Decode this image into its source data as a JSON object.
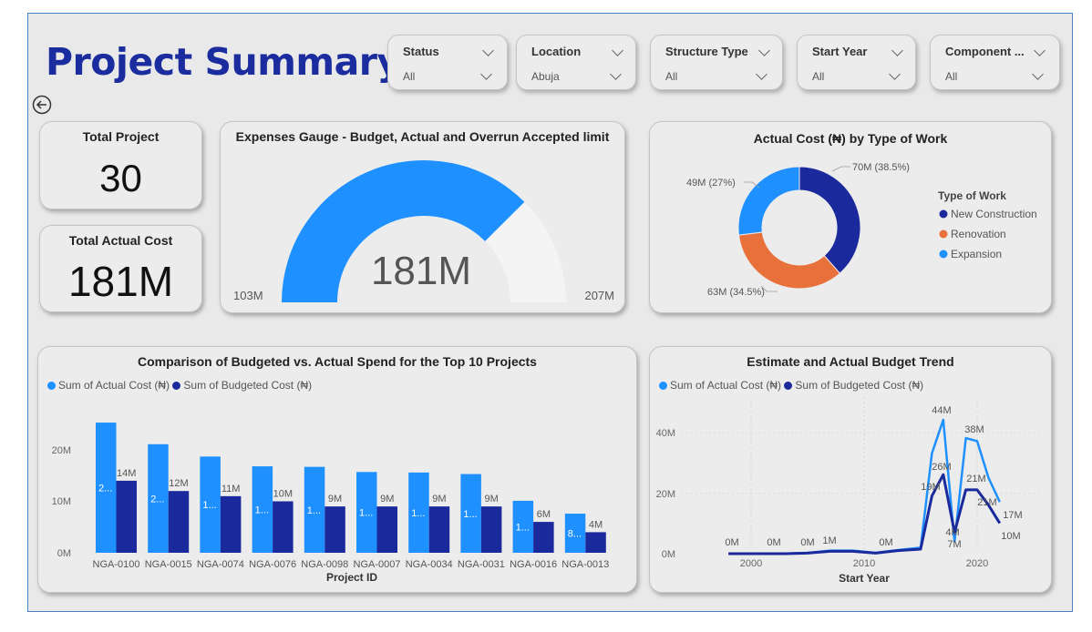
{
  "page": {
    "title": "Project Summary"
  },
  "colors": {
    "title": "#1b2d9e",
    "actual": "#1e90ff",
    "budgeted": "#1a2a9c",
    "renovation": "#e8703a",
    "gauge_track": "#f4f4f4"
  },
  "slicers": [
    {
      "title": "Status",
      "value": "All"
    },
    {
      "title": "Location",
      "value": "Abuja"
    },
    {
      "title": "Structure Type",
      "value": "All"
    },
    {
      "title": "Start Year",
      "value": "All"
    },
    {
      "title": "Component ...",
      "value": "All"
    }
  ],
  "kpis": {
    "total_project": {
      "label": "Total Project",
      "value": "30"
    },
    "total_actual_cost": {
      "label": "Total Actual Cost",
      "value": "181M"
    }
  },
  "gauge": {
    "title": "Expenses Gauge - Budget, Actual and Overrun Accepted limit",
    "value_label": "181M",
    "min_label": "103M",
    "max_label": "207M",
    "min": 103,
    "max": 207,
    "value": 181
  },
  "donut": {
    "title": "Actual Cost (₦) by Type of Work",
    "legend_title": "Type of Work",
    "slices": [
      {
        "name": "New Construction",
        "value": 70,
        "label": "70M (38.5%)",
        "color": "#1a2a9c"
      },
      {
        "name": "Renovation",
        "value": 63,
        "label": "63M (34.5%)",
        "color": "#e8703a"
      },
      {
        "name": "Expansion",
        "value": 49,
        "label": "49M (27%)",
        "color": "#1e90ff"
      }
    ]
  },
  "bar_chart": {
    "title": "Comparison of Budgeted vs. Actual Spend for the Top 10 Projects",
    "legend": [
      "Sum of Actual Cost (₦)",
      "Sum of Budgeted Cost (₦)"
    ],
    "xlabel": "Project ID",
    "y_ticks": [
      "0M",
      "10M",
      "20M"
    ],
    "bar_labels_actual": [
      "2...",
      "2...",
      "1...",
      "1...",
      "1...",
      "1...",
      "1...",
      "1...",
      "1...",
      "8..."
    ],
    "bar_labels_budget": [
      "14M",
      "12M",
      "11M",
      "10M",
      "9M",
      "9M",
      "9M",
      "9M",
      "6M",
      "4M"
    ]
  },
  "line_chart": {
    "title": "Estimate and Actual Budget Trend",
    "legend": [
      "Sum of Actual Cost (₦)",
      "Sum of Budgeted Cost (₦)"
    ],
    "xlabel": "Start Year",
    "y_ticks": [
      "0M",
      "20M",
      "40M"
    ],
    "x_ticks": [
      "2000",
      "2010",
      "2020"
    ],
    "point_labels": [
      "0M",
      "0M",
      "0M",
      "1M",
      "0M",
      "44M",
      "26M",
      "19M",
      "4M",
      "7M",
      "38M",
      "21M",
      "21M",
      "17M",
      "10M"
    ]
  },
  "chart_data": [
    {
      "type": "bar",
      "title": "Comparison of Budgeted vs. Actual Spend for the Top 10 Projects",
      "xlabel": "Project ID",
      "ylabel": "",
      "categories": [
        "NGA-0100",
        "NGA-0015",
        "NGA-0074",
        "NGA-0076",
        "NGA-0098",
        "NGA-0007",
        "NGA-0034",
        "NGA-0031",
        "NGA-0016",
        "NGA-0013"
      ],
      "series": [
        {
          "name": "Sum of Actual Cost (₦)",
          "values": [
            25.3,
            21.1,
            18.7,
            16.8,
            16.7,
            15.7,
            15.6,
            15.3,
            10.1,
            7.6
          ]
        },
        {
          "name": "Sum of Budgeted Cost (₦)",
          "values": [
            14,
            12,
            11,
            10,
            9,
            9,
            9,
            9,
            6,
            4
          ]
        }
      ],
      "ylim": [
        0,
        28
      ],
      "legend": "top-left"
    },
    {
      "type": "line",
      "title": "Estimate and Actual Budget Trend",
      "xlabel": "Start Year",
      "ylabel": "",
      "x": [
        1998,
        2000,
        2003,
        2005,
        2007,
        2009,
        2011,
        2013,
        2015,
        2016,
        2017,
        2018,
        2019,
        2020,
        2021,
        2022
      ],
      "series": [
        {
          "name": "Sum of Actual Cost (₦)",
          "values": [
            0,
            0,
            0,
            0.3,
            1,
            1,
            0.3,
            1.2,
            2,
            33,
            44,
            4,
            38,
            37,
            25,
            17
          ]
        },
        {
          "name": "Sum of Budgeted Cost (₦)",
          "values": [
            0,
            0,
            0,
            0.2,
            0.8,
            0.8,
            0.2,
            1,
            1.5,
            19,
            26,
            7,
            21,
            21,
            16,
            10
          ]
        }
      ],
      "ylim": [
        0,
        48
      ],
      "legend": "top-left"
    },
    {
      "type": "pie",
      "title": "Actual Cost (₦) by Type of Work",
      "categories": [
        "New Construction",
        "Renovation",
        "Expansion"
      ],
      "values": [
        70,
        63,
        49
      ]
    }
  ]
}
